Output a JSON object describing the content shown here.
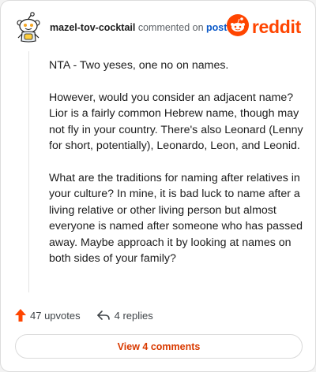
{
  "comment": {
    "username": "mazel-tov-cocktail",
    "commented_text": "commented on",
    "post_link": "post",
    "brand": "reddit",
    "paragraphs": [
      "NTA - Two yeses, one no on names.",
      "However, would you consider an adjacent name? Lior is a fairly common Hebrew name, though may not fly in your country. There's also Leonard (Lenny for short, potentially), Leonardo, Leon, and Leonid.",
      "What are the traditions for naming after relatives in your culture? In mine, it is bad luck to name after a living relative or other living person but almost everyone is named after someone who has passed away. Maybe approach it by looking at names on both sides of your family?"
    ]
  },
  "actions": {
    "upvotes_label": "47 upvotes",
    "replies_label": "4 replies"
  },
  "footer": {
    "view_comments_label": "View 4 comments"
  },
  "colors": {
    "brand_orange": "#ff4500",
    "link_blue": "#0a58c8",
    "upvote_orange": "#ff4500",
    "view_button_text": "#d93a00"
  },
  "icons": {
    "avatar": "snoo-avatar-icon",
    "brand_logo": "reddit-logo-icon",
    "upvote": "upvote-arrow-icon",
    "reply": "reply-arrow-icon"
  }
}
